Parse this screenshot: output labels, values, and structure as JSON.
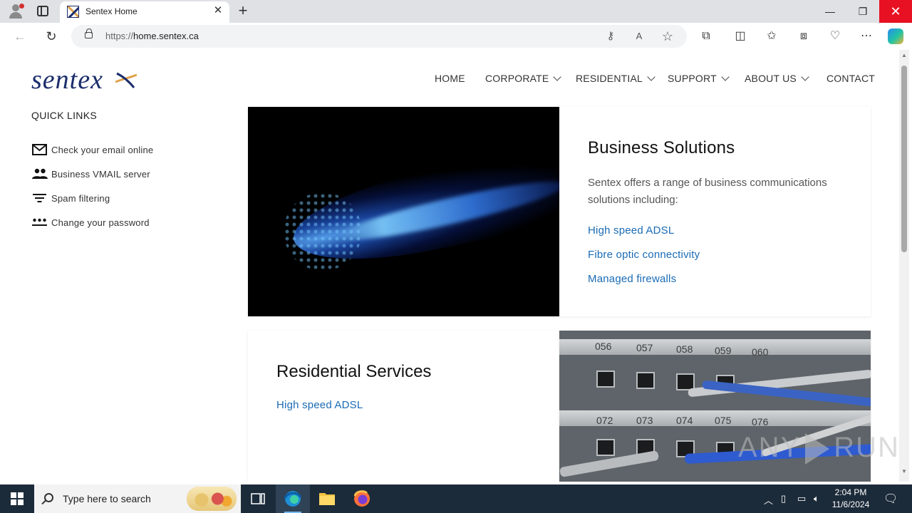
{
  "browser": {
    "tab_title": "Sentex Home",
    "url_scheme": "https://",
    "url_host": "home.sentex.ca"
  },
  "site": {
    "logo_text": "sentex",
    "nav": [
      {
        "label": "HOME",
        "has_menu": false
      },
      {
        "label": "CORPORATE",
        "has_menu": true
      },
      {
        "label": "RESIDENTIAL",
        "has_menu": true
      },
      {
        "label": "SUPPORT",
        "has_menu": true
      },
      {
        "label": "ABOUT US",
        "has_menu": true
      },
      {
        "label": "CONTACT",
        "has_menu": false
      }
    ],
    "quick_links": {
      "title": "QUICK LINKS",
      "items": [
        {
          "label": "Check your email online",
          "icon": "mail-icon"
        },
        {
          "label": "Business VMAIL server",
          "icon": "people-icon"
        },
        {
          "label": "Spam filtering",
          "icon": "filter-icon"
        },
        {
          "label": "Change your password",
          "icon": "password-icon"
        }
      ]
    },
    "business": {
      "title": "Business Solutions",
      "description": "Sentex offers a range of business communications solutions including:",
      "links": [
        "High speed ADSL",
        "Fibre optic connectivity",
        "Managed firewalls"
      ]
    },
    "residential": {
      "title": "Residential Services",
      "links": [
        "High speed ADSL"
      ]
    },
    "rack_labels": [
      "056",
      "057",
      "058",
      "059",
      "060",
      "072",
      "073",
      "074",
      "075",
      "076"
    ]
  },
  "watermark": {
    "left": "ANY",
    "right": "RUN"
  },
  "taskbar": {
    "search_placeholder": "Type here to search",
    "time": "2:04 PM",
    "date": "11/6/2024"
  },
  "colors": {
    "link": "#1a6bb5",
    "logo": "#1b2d6b",
    "logo_accent": "#e0a24a",
    "close_button": "#e81123",
    "taskbar": "#1c2b3a"
  }
}
